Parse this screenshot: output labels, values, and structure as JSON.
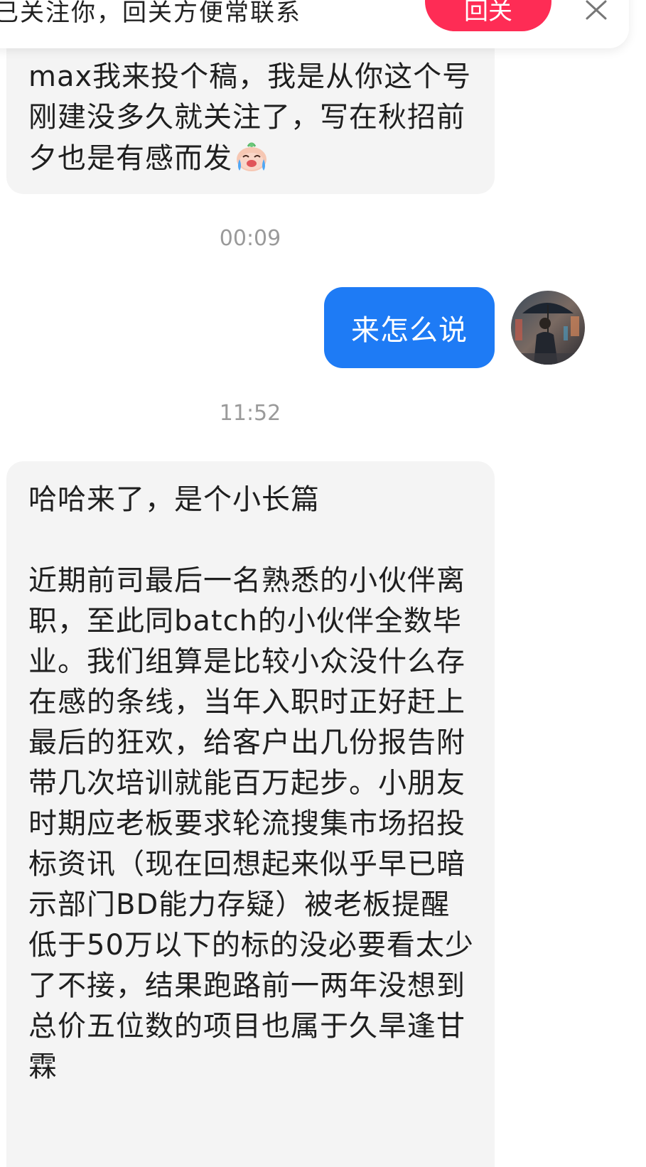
{
  "banner": {
    "text": "已关注你，回关方便常联系",
    "button_label": "回关",
    "close_label": "✕"
  },
  "messages": [
    {
      "direction": "incoming",
      "text": "max我来投个稿，我是从你这个号刚建没多久就关注了，写在秋招前夕也是有感而发",
      "emoji": "crying-laughing-sticker-icon"
    },
    {
      "timestamp": "00:09"
    },
    {
      "direction": "outgoing",
      "text": "来怎么说",
      "avatar": "avatar-man-with-umbrella"
    },
    {
      "timestamp": "11:52"
    },
    {
      "direction": "incoming",
      "line1": "哈哈来了，是个小长篇",
      "body": "近期前司最后一名熟悉的小伙伴离职，至此同batch的小伙伴全数毕业。我们组算是比较小众没什么存在感的条线，当年入职时正好赶上最后的狂欢，给客户出几份报告附带几次培训就能百万起步。小朋友时期应老板要求轮流搜集市场招投标资讯（现在回想起来似乎早已暗示部门BD能力存疑）被老板提醒低于50万以下的标的没必要看太少了不接，结果跑路前一两年没想到总价五位数的项目也属于久旱逢甘霖"
    }
  ],
  "colors": {
    "outgoing_bubble": "#1e7bf5",
    "incoming_bubble": "#f4f4f4",
    "follow_button": "#fe2c55",
    "timestamp": "#9a9a9a"
  }
}
